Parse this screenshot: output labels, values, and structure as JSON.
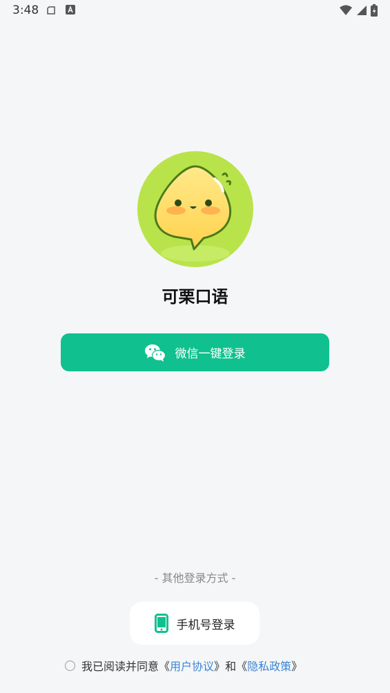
{
  "status_bar": {
    "time": "3:48"
  },
  "app": {
    "name": "可栗口语"
  },
  "login": {
    "wechat_label": "微信一键登录",
    "other_methods_label": "- 其他登录方式 -",
    "phone_label": "手机号登录"
  },
  "agreement": {
    "prefix": "我已阅读并同意",
    "open1": " 《",
    "user_agreement": "用户协议",
    "close1": "》",
    "and": "和",
    "open2": "《",
    "privacy_policy": "隐私政策",
    "close2": "》"
  },
  "colors": {
    "primary": "#10c18f",
    "link": "#3a86d6",
    "background": "#f5f6f8"
  }
}
